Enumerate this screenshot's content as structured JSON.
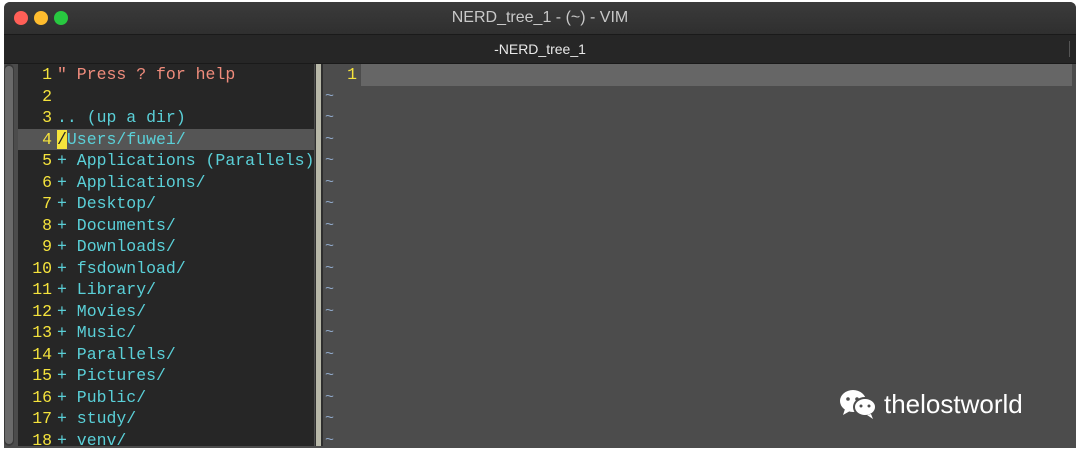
{
  "window": {
    "title": "NERD_tree_1 - (~) - VIM"
  },
  "tab": {
    "label": "-NERD_tree_1"
  },
  "tree": {
    "rows": [
      {
        "n": "1",
        "text": "\" Press ? for help"
      },
      {
        "n": "2",
        "text": ""
      },
      {
        "n": "3",
        "text": ".. (up a dir)"
      },
      {
        "n": "4",
        "cursor": "/",
        "text": "Users/fuwei/"
      },
      {
        "n": "5",
        "text": "+ Applications (Parallels)/"
      },
      {
        "n": "6",
        "text": "+ Applications/"
      },
      {
        "n": "7",
        "text": "+ Desktop/"
      },
      {
        "n": "8",
        "text": "+ Documents/"
      },
      {
        "n": "9",
        "text": "+ Downloads/"
      },
      {
        "n": "10",
        "text": "+ fsdownload/"
      },
      {
        "n": "11",
        "text": "+ Library/"
      },
      {
        "n": "12",
        "text": "+ Movies/"
      },
      {
        "n": "13",
        "text": "+ Music/"
      },
      {
        "n": "14",
        "text": "+ Parallels/"
      },
      {
        "n": "15",
        "text": "+ Pictures/"
      },
      {
        "n": "16",
        "text": "+ Public/"
      },
      {
        "n": "17",
        "text": "+ study/"
      },
      {
        "n": "18",
        "text": "+ venv/"
      }
    ]
  },
  "editor": {
    "line_number": "1",
    "tilde": "~"
  },
  "watermark": {
    "text": "thelostworld",
    "icon": "wechat-icon"
  }
}
